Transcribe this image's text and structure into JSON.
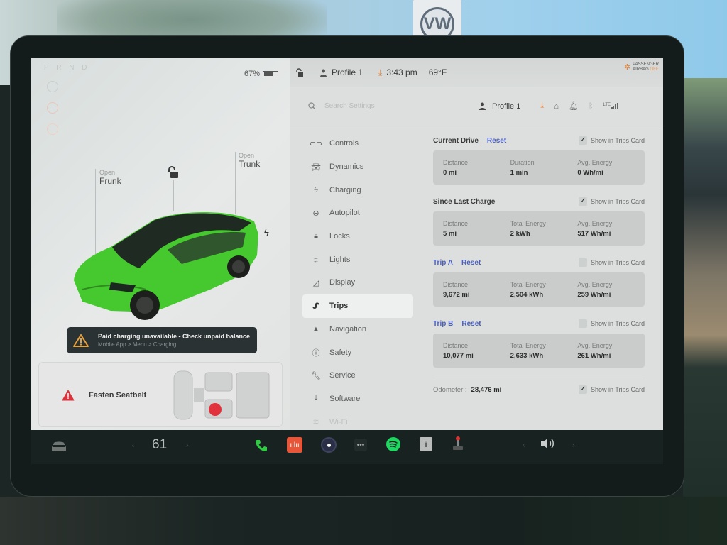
{
  "left_panel": {
    "gear_selector": "P R N D",
    "battery_percent": "67%",
    "battery_level": 0.67,
    "frunk": {
      "action": "Open",
      "label": "Frunk"
    },
    "trunk": {
      "action": "Open",
      "label": "Trunk"
    },
    "lock_state": "unlocked",
    "car_color": "#3fcf2a",
    "charging_alert": {
      "title": "Paid charging unavailable - Check unpaid balance",
      "subtitle": "Mobile App > Menu > Charging"
    },
    "seatbelt_warning": "Fasten Seatbelt"
  },
  "status_bar": {
    "profile": "Profile 1",
    "time": "3:43 pm",
    "temperature": "69°F",
    "airbag_line1": "PASSENGER",
    "airbag_line2": "AIRBAG",
    "airbag_state": "OFF"
  },
  "settings_header": {
    "search_placeholder": "Search Settings",
    "profile": "Profile 1",
    "network": "LTE"
  },
  "nav": {
    "items": [
      {
        "label": "Controls",
        "icon": "toggle-icon"
      },
      {
        "label": "Dynamics",
        "icon": "car-icon"
      },
      {
        "label": "Charging",
        "icon": "bolt-icon"
      },
      {
        "label": "Autopilot",
        "icon": "steering-wheel-icon"
      },
      {
        "label": "Locks",
        "icon": "lock-icon"
      },
      {
        "label": "Lights",
        "icon": "light-icon"
      },
      {
        "label": "Display",
        "icon": "display-icon"
      },
      {
        "label": "Trips",
        "icon": "trips-icon",
        "active": true
      },
      {
        "label": "Navigation",
        "icon": "navigation-icon"
      },
      {
        "label": "Safety",
        "icon": "safety-icon"
      },
      {
        "label": "Service",
        "icon": "wrench-icon"
      },
      {
        "label": "Software",
        "icon": "download-icon"
      },
      {
        "label": "Wi-Fi",
        "icon": "wifi-icon"
      }
    ]
  },
  "trips": {
    "show_label": "Show in Trips Card",
    "reset_label": "Reset",
    "current_drive": {
      "title": "Current Drive",
      "show_checked": true,
      "stats": [
        {
          "label": "Distance",
          "value": "0 mi"
        },
        {
          "label": "Duration",
          "value": "1 min"
        },
        {
          "label": "Avg. Energy",
          "value": "0 Wh/mi"
        }
      ]
    },
    "since_last_charge": {
      "title": "Since Last Charge",
      "show_checked": true,
      "stats": [
        {
          "label": "Distance",
          "value": "5 mi"
        },
        {
          "label": "Total Energy",
          "value": "2 kWh"
        },
        {
          "label": "Avg. Energy",
          "value": "517 Wh/mi"
        }
      ]
    },
    "trip_a": {
      "title": "Trip A",
      "show_checked": false,
      "stats": [
        {
          "label": "Distance",
          "value": "9,672 mi"
        },
        {
          "label": "Total Energy",
          "value": "2,504 kWh"
        },
        {
          "label": "Avg. Energy",
          "value": "259 Wh/mi"
        }
      ]
    },
    "trip_b": {
      "title": "Trip B",
      "show_checked": false,
      "stats": [
        {
          "label": "Distance",
          "value": "10,077 mi"
        },
        {
          "label": "Total Energy",
          "value": "2,633 kWh"
        },
        {
          "label": "Avg. Energy",
          "value": "261 Wh/mi"
        }
      ]
    },
    "odometer": {
      "label": "Odometer :",
      "value": "28,476 mi",
      "show_checked": true
    }
  },
  "taskbar": {
    "cabin_temp": "61",
    "apps": [
      "phone",
      "audio",
      "camera",
      "more",
      "spotify",
      "manual",
      "arcade"
    ],
    "colors": {
      "phone": "#2ecc40",
      "audio": "#e8563a",
      "spotify": "#1ed760"
    }
  },
  "backdrop": {
    "sign_logo": "VW"
  }
}
